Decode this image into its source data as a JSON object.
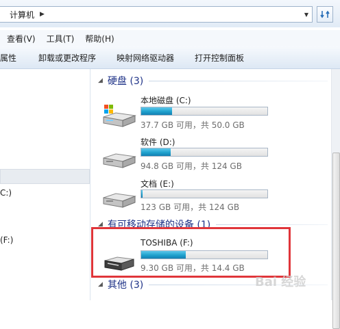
{
  "address_bar": {
    "crumb": "计算机"
  },
  "menu": [
    "查看(V)",
    "工具(T)",
    "帮助(H)"
  ],
  "commands": [
    "属性",
    "卸载或更改程序",
    "映射网络驱动器",
    "打开控制面板"
  ],
  "navigation": [
    "C:)",
    "(F:)"
  ],
  "groups": [
    {
      "title": "硬盘 (3)",
      "drives": [
        {
          "name": "本地磁盘 (C:)",
          "free": "37.7 GB 可用，共 50.0 GB",
          "used_fraction": 0.246,
          "icon": "windows-drive-icon"
        },
        {
          "name": "软件 (D:)",
          "free": "94.8 GB 可用，共 124 GB",
          "used_fraction": 0.236,
          "icon": "hard-drive-icon"
        },
        {
          "name": "文档 (E:)",
          "free": "123 GB 可用，共 124 GB",
          "used_fraction": 0.01,
          "icon": "hard-drive-icon"
        }
      ]
    },
    {
      "title": "有可移动存储的设备 (1)",
      "drives": [
        {
          "name": "TOSHIBA (F:)",
          "free": "9.30 GB 可用，共 14.4 GB",
          "used_fraction": 0.354,
          "icon": "usb-drive-icon"
        }
      ]
    },
    {
      "title": "其他 (3)",
      "drives": []
    }
  ],
  "colors": {
    "group_title": "#1e3287",
    "bar_fill": "#1fa1cd",
    "highlight": "#e0353a"
  },
  "watermark": "Bai 经验"
}
